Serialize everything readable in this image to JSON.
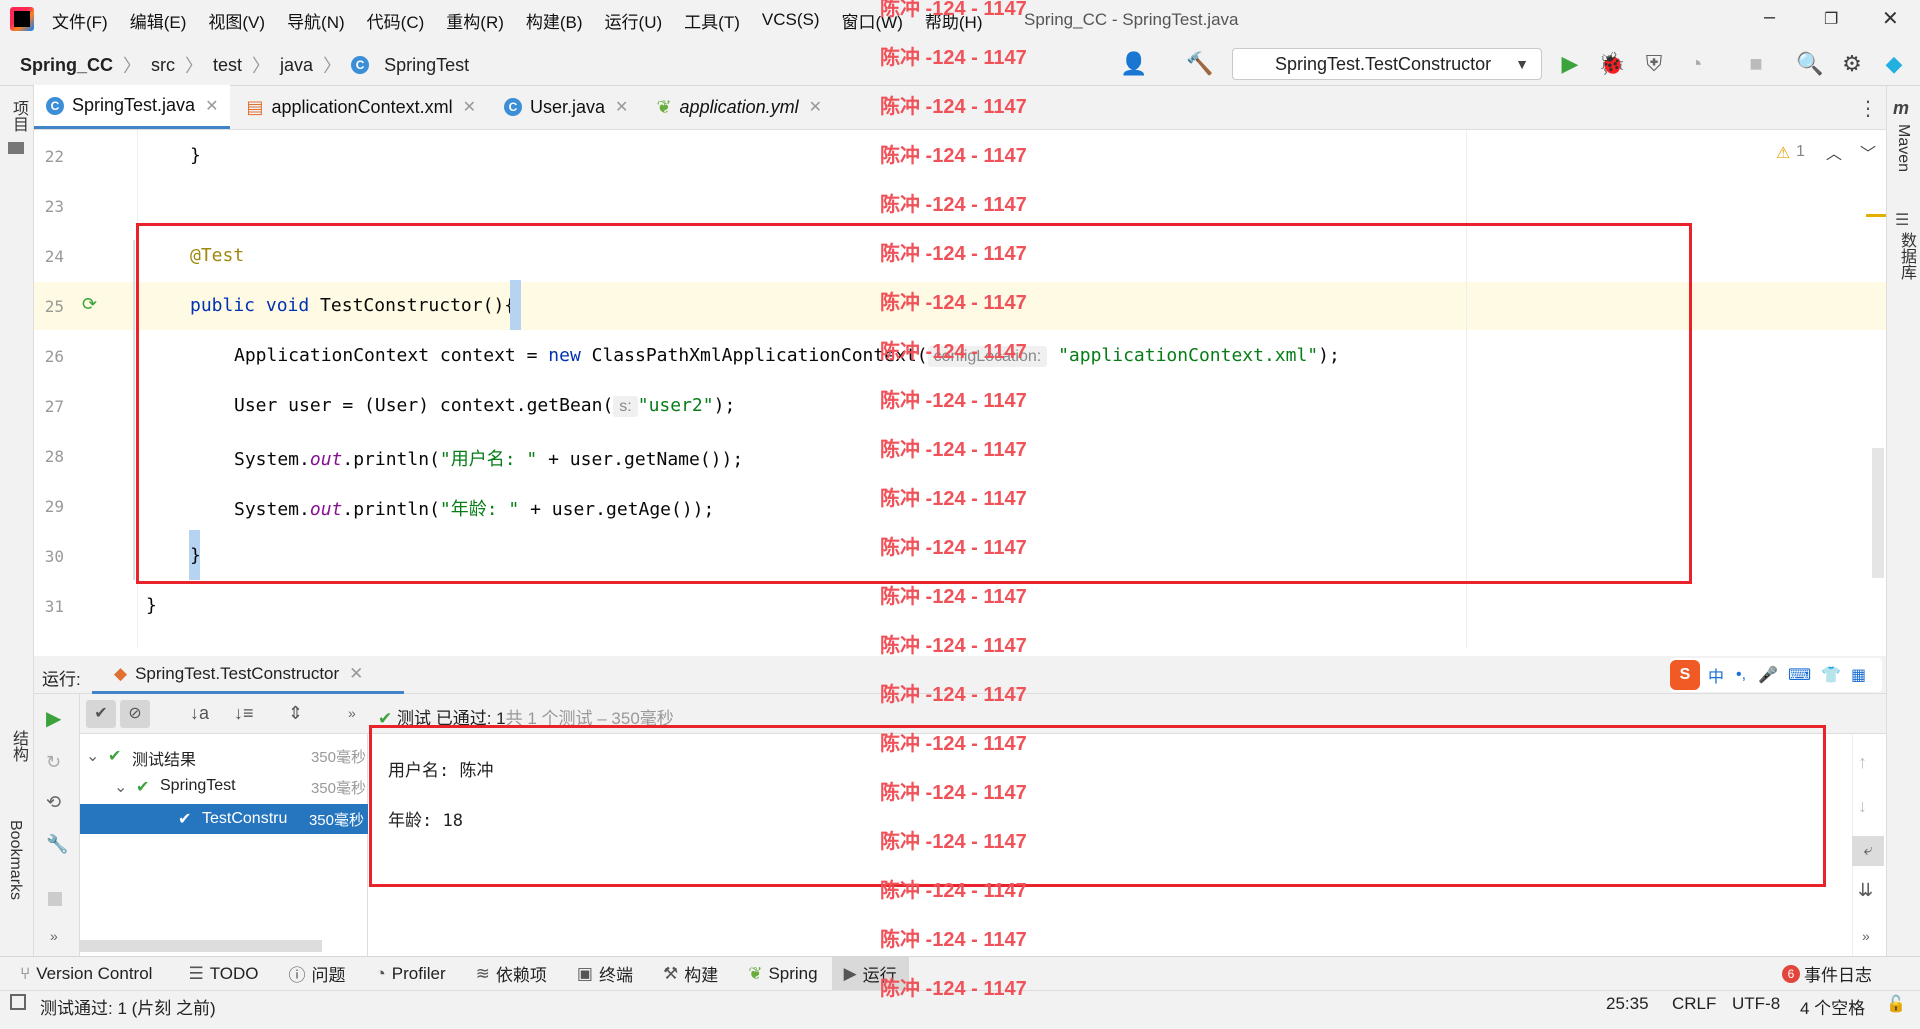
{
  "menu": [
    "文件(F)",
    "编辑(E)",
    "视图(V)",
    "导航(N)",
    "代码(C)",
    "重构(R)",
    "构建(B)",
    "运行(U)",
    "工具(T)",
    "VCS(S)",
    "窗口(W)",
    "帮助(H)"
  ],
  "window_title": "Spring_CC - SpringTest.java",
  "breadcrumb": {
    "project": "Spring_CC",
    "parts": [
      "src",
      "test",
      "java"
    ],
    "file": "SpringTest"
  },
  "run_config": "SpringTest.TestConstructor",
  "tabs": [
    {
      "label": "SpringTest.java",
      "active": true
    },
    {
      "label": "applicationContext.xml",
      "active": false
    },
    {
      "label": "User.java",
      "active": false
    },
    {
      "label": "application.yml",
      "active": false
    }
  ],
  "side": {
    "project": "项目",
    "structure": "结构",
    "bookmarks": "Bookmarks",
    "maven": "Maven",
    "database": "数据库"
  },
  "editor": {
    "warnings": "1",
    "lines": [
      {
        "n": "22",
        "text": "}"
      },
      {
        "n": "23",
        "text": ""
      },
      {
        "n": "24",
        "annotation": "@Test"
      },
      {
        "n": "25",
        "kw1": "public void",
        "rest": " TestConstructor(){"
      },
      {
        "n": "26",
        "pre": "ApplicationContext context = ",
        "kw": "new",
        "post": " ClassPathXmlApplicationContext(",
        "hint": "configLocation:",
        "str": "\"applicationContext.xml\"",
        "end": ");"
      },
      {
        "n": "27",
        "pre": "User user = (User) context.getBean(",
        "hint": "s:",
        "str": "\"user2\"",
        "end": ");"
      },
      {
        "n": "28",
        "pre": "System.",
        "ital": "out",
        "mid": ".println(",
        "str": "\"用户名: \"",
        "end": " + user.getName());"
      },
      {
        "n": "29",
        "pre": "System.",
        "ital": "out",
        "mid": ".println(",
        "str": "\"年龄: \"",
        "end": " + user.getAge());"
      },
      {
        "n": "30",
        "text": "}"
      },
      {
        "n": "31",
        "text": "}"
      }
    ]
  },
  "run_panel": {
    "label": "运行:",
    "tab": "SpringTest.TestConstructor",
    "summary_bold": "测试 已通过: 1",
    "summary_rest": "共 1 个测试 – 350毫秒",
    "tree": [
      {
        "label": "测试结果",
        "time": "350毫秒"
      },
      {
        "label": "SpringTest",
        "time": "350毫秒"
      },
      {
        "label": "TestConstru",
        "time": "350毫秒"
      }
    ],
    "console": [
      "用户名: 陈冲",
      "年龄: 18"
    ]
  },
  "bottom_tabs": [
    "Version Control",
    "TODO",
    "问题",
    "Profiler",
    "依赖项",
    "终端",
    "构建",
    "Spring",
    "运行"
  ],
  "event_log": {
    "count": "6",
    "label": "事件日志"
  },
  "status": {
    "left": "测试通过: 1 (片刻 之前)",
    "pos": "25:35",
    "eol": "CRLF",
    "enc": "UTF-8",
    "indent": "4 个空格"
  },
  "watermark": "陈冲 -124 - 1147",
  "ime": {
    "lang": "中"
  }
}
